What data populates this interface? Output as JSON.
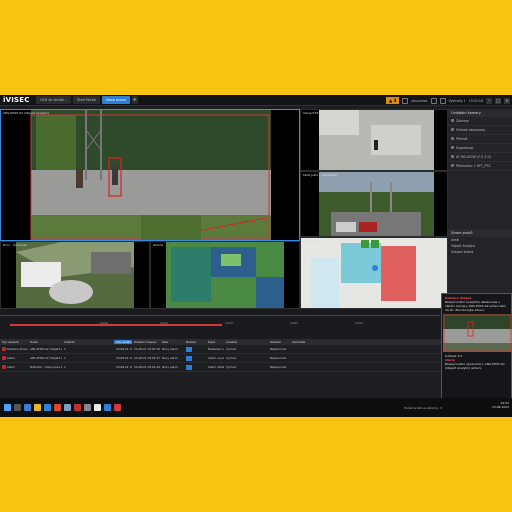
{
  "app": {
    "logo": "iVISEC",
    "window_title": "Ultimate Lite"
  },
  "tabs": [
    {
      "label": "OCR ke skrble..."
    },
    {
      "label": "Start Portal"
    },
    {
      "label": "Nova scena"
    }
  ],
  "topbar": {
    "alarm_count": "3",
    "user": "ptruzmiov",
    "notice": "Výstrahy 1",
    "clock": "19:02:18"
  },
  "cameras": [
    {
      "label": "ANS-PH05-02 (Objekt Analytic)"
    },
    {
      "label": "Vstup PTZ"
    },
    {
      "label": "Most Južní - parkoviště"
    },
    {
      "label": "Dron - Šmírovec"
    },
    {
      "label": "Záloha"
    },
    {
      "label": "Mapa areálu"
    }
  ],
  "right_panel": {
    "title": "Ovládání kamery",
    "items": [
      "Záznam",
      "Snímek obrazovky",
      "Přehrát",
      "Exportovat",
      "AF RELATIVE (P 0 Z 0)",
      "Předvolba: 1 RFT_PTZ"
    ],
    "tree_title": "Strom prvků",
    "tree": [
      "Areál",
      "Objekt Analytic",
      "Vstupní brána"
    ]
  },
  "event_popup": {
    "header": "Detekce zbraně",
    "text": "Bezpečnostní analytika detekovala v záběru kamery ANS-PH05-02 potenciální zbraň. Zkontrolujte situaci.",
    "footer_title": "Událost 1/3",
    "footer_label": "Alarm",
    "footer_text": "Bezpečnostní upozornění, ANS-PH05-02 (Objekt Analytic) aktivní."
  },
  "timeline": {
    "marks": [
      "19:00",
      "19:01",
      "19:02",
      "19:03",
      "19:04"
    ]
  },
  "table": {
    "headers": [
      "Typ udalosti",
      "Prvek",
      "Udalost",
      "Cas vzniku",
      "Posledni hlaseni",
      "Stav",
      "Nahled",
      "Popis",
      "Lokalita",
      "Kontakt",
      "Komentar"
    ],
    "rows": [
      {
        "type": "Detekce zbrane",
        "camera": "ANS-PH05-02 (Objekt Analytic)",
        "count": "1",
        "time": "23.08.22 19:02:18",
        "last": "23.08.22 19:02:18",
        "state": "Novy alarm",
        "desc": "Nebezpecna zbran ANS-PH05-02 (Objekt Analytic) 1",
        "loc": "Vychod",
        "contact": "Bezpecnost"
      },
      {
        "type": "Alarm",
        "camera": "ANS-PH05-02 (Objekt Analytic)",
        "count": "1",
        "time": "23.08.22 19:01:57",
        "last": "23.08.22 19:01:57",
        "state": "Novy alarm",
        "desc": "Alarm na prvku ANS-PH05-02 (Objekt A.)",
        "loc": "Vychod",
        "contact": "Bezpecnost"
      },
      {
        "type": "Alarm",
        "camera": "Detector - Sopronova 2",
        "count": "1",
        "time": "23.08.22 19:01:49",
        "last": "23.08.22 19:01:49",
        "state": "Novy alarm",
        "desc": "Alarm detekce vniknuti zona A",
        "loc": "Vychod",
        "contact": "Bezpecnost"
      }
    ]
  },
  "taskbar": {
    "time": "19:02",
    "date": "23.08.2022",
    "status": "Počet prvků ve stromu: 3"
  }
}
